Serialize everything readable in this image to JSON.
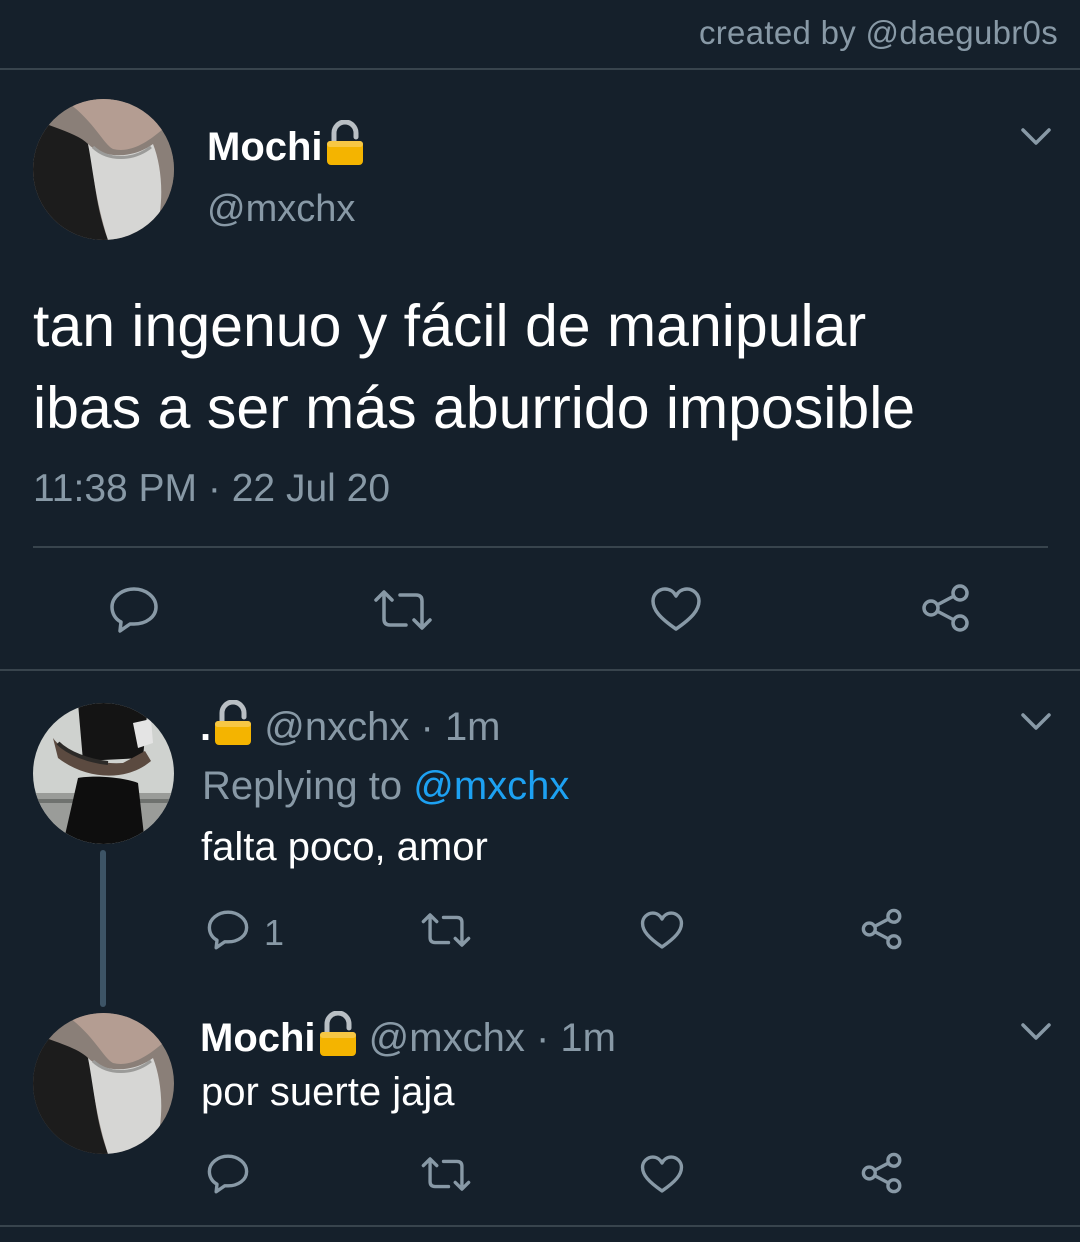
{
  "credit": "created by @daegubr0s",
  "main_tweet": {
    "name": "Mochi",
    "handle": "@mxchx",
    "text": "tan ingenuo y fácil de manipular\nibas a ser más aburrido imposible",
    "time": "11:38 PM",
    "date_sep": "·",
    "date": "22 Jul 20",
    "locked": true
  },
  "reply1": {
    "name": ".",
    "handle": "@nxchx",
    "sep": "·",
    "age": "1m",
    "replying_label": "Replying to",
    "replying_to": "@mxchx",
    "text": "falta poco, amor",
    "reply_count": "1",
    "locked": true
  },
  "reply2": {
    "name": "Mochi",
    "handle": "@mxchx",
    "sep": "·",
    "age": "1m",
    "text": "por suerte jaja",
    "locked": true
  },
  "icons": {
    "reply": "reply-icon",
    "retweet": "retweet-icon",
    "like": "heart-icon",
    "share": "share-icon",
    "menu": "chevron-down-icon",
    "lock": "lock-icon"
  },
  "colors": {
    "background": "#15202b",
    "secondary_text": "#8899a6",
    "accent": "#1da1f2",
    "divider": "#38444d",
    "lock": "#f4b400"
  }
}
